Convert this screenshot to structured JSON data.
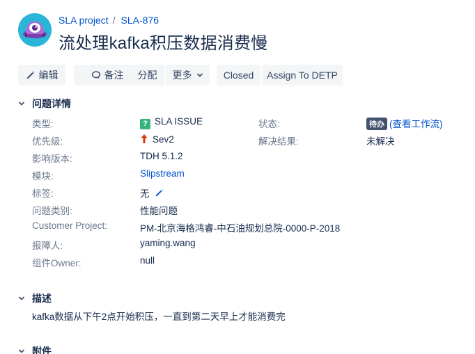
{
  "header": {
    "breadcrumb_project": "SLA project",
    "breadcrumb_sep": "/",
    "breadcrumb_issue": "SLA-876",
    "title": "流处理kafka积压数据消费慢"
  },
  "toolbar": {
    "edit": "编辑",
    "comment": "备注",
    "assign": "分配",
    "more": "更多",
    "closed": "Closed",
    "assign_to": "Assign To DETP"
  },
  "details": {
    "heading": "问题详情",
    "type_label": "类型:",
    "type_value": "SLA ISSUE",
    "type_icon": "?",
    "status_label": "状态:",
    "status_value": "待办",
    "workflow_link": "(查看工作流)",
    "priority_label": "优先级:",
    "priority_value": "Sev2",
    "resolution_label": "解决结果:",
    "resolution_value": "未解决",
    "version_label": "影响版本:",
    "version_value": "TDH 5.1.2",
    "module_label": "模块:",
    "module_value": "Slipstream",
    "tags_label": "标签:",
    "tags_value": "无",
    "category_label": "问题类别:",
    "category_value": "性能问题",
    "customer_label": "Customer Project:",
    "customer_value": "PM-北京海格鸿睿-中石油规划总院-0000-P-2018",
    "reporter_label": "报障人:",
    "reporter_value": "yaming.wang",
    "owner_label": "组件Owner:",
    "owner_value": "null"
  },
  "description": {
    "heading": "描述",
    "text": "kafka数据从下午2点开始积压，一直到第二天早上才能消费完"
  },
  "attachments": {
    "heading": "附件"
  },
  "colors": {
    "link": "#0052cc",
    "button_bg": "#f4f5f7",
    "status_lozenge": "#42526e",
    "issue_type": "#36b37e",
    "priority_arrow": "#de350b",
    "avatar_bg": "#2bb5d8"
  }
}
